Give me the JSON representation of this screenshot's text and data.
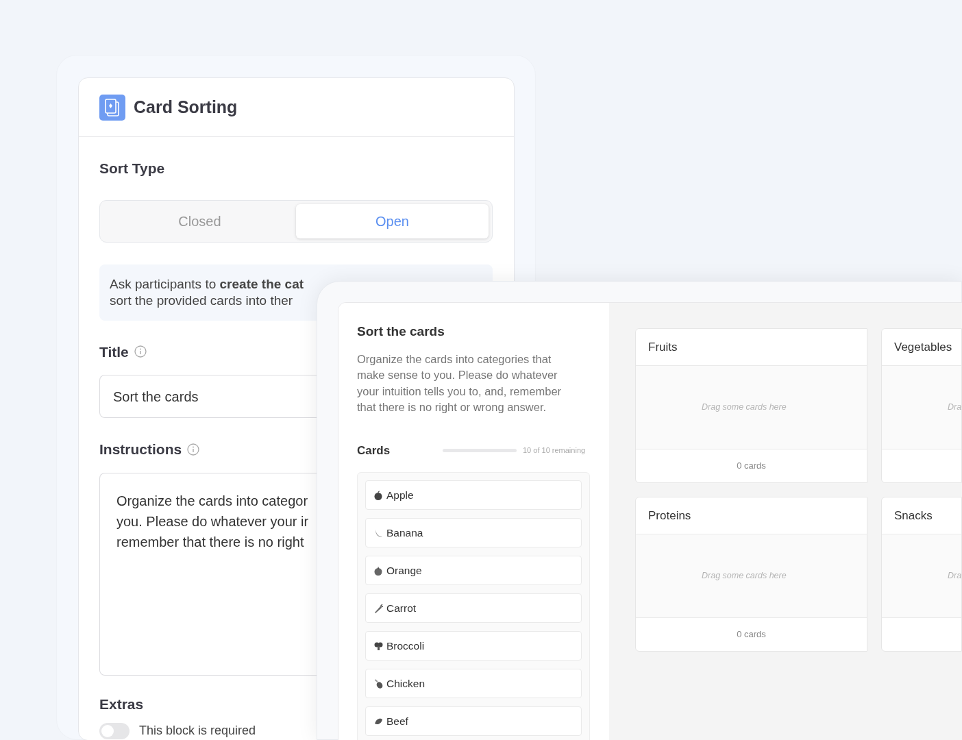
{
  "editor": {
    "title": "Card Sorting",
    "sort_type_label": "Sort Type",
    "sort_options": [
      {
        "label": "Closed",
        "selected": false
      },
      {
        "label": "Open",
        "selected": true
      }
    ],
    "info_lines": [
      "Ask participants to **create the cat**",
      "sort the provided cards into ther"
    ],
    "title_label": "Title",
    "title_value": "Sort the cards",
    "instructions_label": "Instructions",
    "instructions_lines": [
      "Organize the cards into categor",
      "you. Please do whatever your ir",
      "remember that there is no right"
    ],
    "extras_label": "Extras",
    "required_toggle": {
      "label": "This block is required",
      "on": false
    }
  },
  "preview": {
    "heading": "Sort the cards",
    "description": "Organize the cards into categories that make sense to you. Please do whatever your intuition tells you to, and, remember that there is no right or wrong answer.",
    "cards_label": "Cards",
    "progress": {
      "level": 0,
      "reading": "10 of 10 remaining"
    },
    "cards": [
      {
        "label": "Apple"
      },
      {
        "label": "Banana"
      },
      {
        "label": "Orange"
      },
      {
        "label": "Carrot"
      },
      {
        "label": "Broccoli"
      },
      {
        "label": "Chicken"
      },
      {
        "label": "Beef"
      }
    ],
    "categories": [
      {
        "name": "Fruits",
        "placeholder": "Drag some cards here",
        "count": "0 cards"
      },
      {
        "name": "Vegetables",
        "placeholder": "Dra"
      },
      {
        "name": "Proteins",
        "placeholder": "Drag some cards here",
        "count": "0 cards"
      },
      {
        "name": "Snacks",
        "placeholder": "Dra"
      }
    ]
  }
}
